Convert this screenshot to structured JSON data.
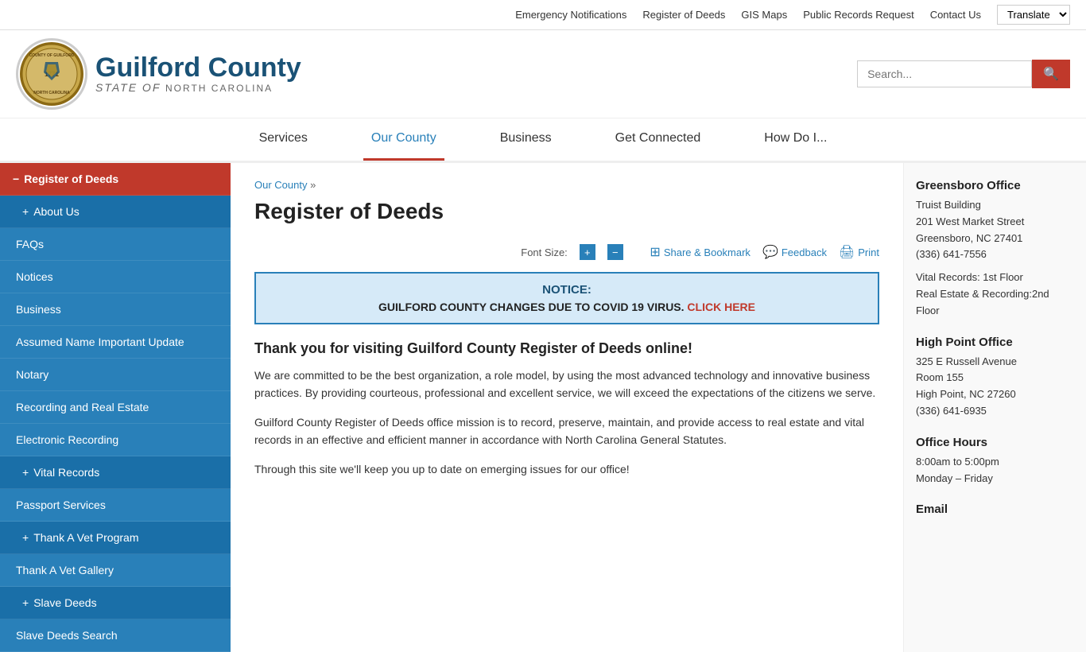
{
  "topbar": {
    "links": [
      {
        "label": "Emergency Notifications",
        "href": "#"
      },
      {
        "label": "Register of Deeds",
        "href": "#"
      },
      {
        "label": "GIS Maps",
        "href": "#"
      },
      {
        "label": "Public Records Request",
        "href": "#"
      },
      {
        "label": "Contact Us",
        "href": "#"
      }
    ],
    "translate_label": "Translate"
  },
  "header": {
    "county": "Guilford County",
    "state_line1": "STATE",
    "state_of": "of",
    "state_line2": "NORTH CAROLINA",
    "search_placeholder": "Search...",
    "seal_text": "COUNTY OF GUILFORD NORTH CAROLINA"
  },
  "nav": {
    "items": [
      {
        "label": "Services",
        "active": false
      },
      {
        "label": "Our County",
        "active": true
      },
      {
        "label": "Business",
        "active": false
      },
      {
        "label": "Get Connected",
        "active": false
      },
      {
        "label": "How Do I...",
        "active": false
      }
    ]
  },
  "sidebar": {
    "items": [
      {
        "label": "Register of Deeds",
        "level": "parent",
        "prefix": "−",
        "active": true
      },
      {
        "label": "About Us",
        "level": "1",
        "prefix": "+"
      },
      {
        "label": "FAQs",
        "level": "2",
        "prefix": ""
      },
      {
        "label": "Notices",
        "level": "2",
        "prefix": ""
      },
      {
        "label": "Business",
        "level": "2",
        "prefix": ""
      },
      {
        "label": "Assumed Name Important Update",
        "level": "2",
        "prefix": ""
      },
      {
        "label": "Notary",
        "level": "2",
        "prefix": ""
      },
      {
        "label": "Recording and Real Estate",
        "level": "2",
        "prefix": ""
      },
      {
        "label": "Electronic Recording",
        "level": "2",
        "prefix": ""
      },
      {
        "label": "Vital Records",
        "level": "1",
        "prefix": "+"
      },
      {
        "label": "Passport Services",
        "level": "2",
        "prefix": ""
      },
      {
        "label": "Thank A Vet Program",
        "level": "1",
        "prefix": "+"
      },
      {
        "label": "Thank A Vet Gallery",
        "level": "2",
        "prefix": ""
      },
      {
        "label": "Slave Deeds",
        "level": "1",
        "prefix": "+"
      },
      {
        "label": "Slave Deeds Search",
        "level": "2",
        "prefix": ""
      }
    ]
  },
  "main": {
    "breadcrumb": "Our County »",
    "page_title": "Register of Deeds",
    "toolbar": {
      "font_size_label": "Font Size:",
      "font_increase": "+",
      "font_decrease": "−",
      "share_label": "Share & Bookmark",
      "feedback_label": "Feedback",
      "print_label": "Print"
    },
    "notice": {
      "title": "NOTICE:",
      "body": "GUILFORD COUNTY CHANGES DUE TO COVID 19 VIRUS.",
      "link_label": "CLICK HERE",
      "link_href": "#"
    },
    "content_heading": "Thank you for visiting Guilford County Register of Deeds online!",
    "paragraphs": [
      "We are committed to be the best organization, a role model, by using the most advanced technology and innovative business practices. By providing courteous, professional and excellent service, we will exceed the expectations of the citizens we serve.",
      "Guilford County Register of Deeds office mission is to record, preserve, maintain, and provide access to real estate and vital records in an effective and efficient manner in accordance with North Carolina General Statutes.",
      "Through this site we'll keep you up to date on emerging issues for our office!"
    ]
  },
  "right_sidebar": {
    "greensboro": {
      "title": "Greensboro Office",
      "building": "Truist Building",
      "address1": "201 West Market Street",
      "address2": "Greensboro, NC 27401",
      "phone": "(336) 641-7556",
      "note1": "Vital Records: 1st Floor",
      "note2": "Real Estate & Recording:2nd Floor"
    },
    "highpoint": {
      "title": "High Point Office",
      "address1": "325 E Russell Avenue",
      "address2": "Room 155",
      "address3": "High Point, NC 27260",
      "phone": "(336) 641-6935"
    },
    "hours": {
      "title": "Office Hours",
      "line1": "8:00am to 5:00pm",
      "line2": "Monday – Friday"
    },
    "email": {
      "title": "Email"
    }
  }
}
